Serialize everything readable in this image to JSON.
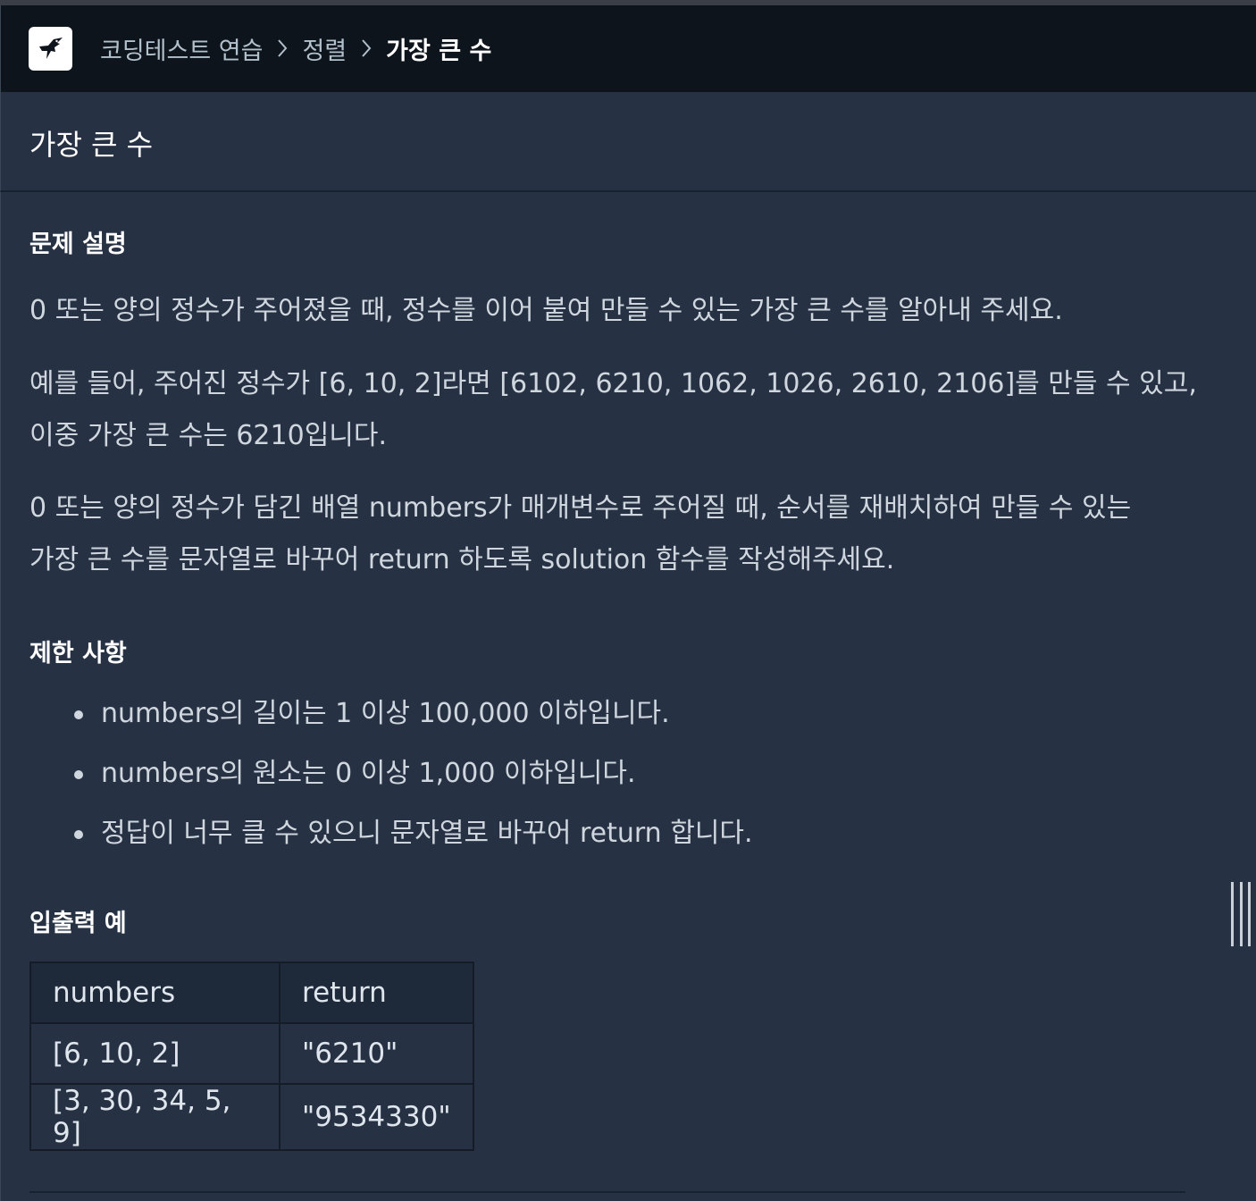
{
  "header": {
    "logo_icon": "hummingbird-logo-icon",
    "breadcrumb": [
      {
        "label": "코딩테스트 연습"
      },
      {
        "label": "정렬"
      },
      {
        "label": "가장 큰 수"
      }
    ]
  },
  "problem": {
    "title": "가장 큰 수",
    "description_heading": "문제 설명",
    "paragraphs": [
      [
        "0 또는 양의 정수가 주어졌을 때, 정수를 이어 붙여 만들 수 있는 가장 큰 수를 알아내 주세요."
      ],
      [
        "예를 들어, 주어진 정수가 [6, 10, 2]라면 [6102, 6210, 1062, 1026, 2610, 2106]를 만들 수 있고,",
        "이중 가장 큰 수는 6210입니다."
      ],
      [
        "0 또는 양의 정수가 담긴 배열 numbers가 매개변수로 주어질 때, 순서를 재배치하여 만들 수 있는",
        "가장 큰 수를 문자열로 바꾸어 return 하도록 solution 함수를 작성해주세요."
      ]
    ],
    "constraints_heading": "제한 사항",
    "constraints": [
      "numbers의 길이는 1 이상 100,000 이하입니다.",
      "numbers의 원소는 0 이상 1,000 이하입니다.",
      "정답이 너무 클 수 있으니 문자열로 바꾸어 return 합니다."
    ],
    "examples_heading": "입출력 예",
    "examples_table": {
      "headers": [
        "numbers",
        "return"
      ],
      "rows": [
        [
          "[6, 10, 2]",
          "\"6210\""
        ],
        [
          "[3, 30, 34, 5, 9]",
          "\"9534330\""
        ]
      ]
    }
  },
  "colors": {
    "header_bg": "#0e141c",
    "content_bg": "#263244",
    "table_header_bg": "#1e293a"
  }
}
